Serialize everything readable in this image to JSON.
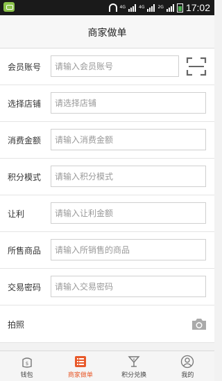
{
  "status_bar": {
    "network_labels": [
      "4G",
      "4G",
      "2G"
    ],
    "time": "17:02"
  },
  "header": {
    "title": "商家做单"
  },
  "form": {
    "fields": [
      {
        "label": "会员账号",
        "placeholder": "请输入会员账号"
      },
      {
        "label": "选择店铺",
        "placeholder": "请选择店铺"
      },
      {
        "label": "消费金额",
        "placeholder": "请输入消费金额"
      },
      {
        "label": "积分模式",
        "placeholder": "请输入积分模式"
      },
      {
        "label": "让利",
        "placeholder": "请输入让利金额"
      },
      {
        "label": "所售商品",
        "placeholder": "请输入所销售的商品"
      },
      {
        "label": "交易密码",
        "placeholder": "请输入交易密码"
      }
    ],
    "photo_label": "拍照"
  },
  "tabbar": {
    "tabs": [
      {
        "label": "钱包",
        "icon": "wallet-icon",
        "active": false
      },
      {
        "label": "商家做单",
        "icon": "order-list-icon",
        "active": true
      },
      {
        "label": "积分兑换",
        "icon": "points-exchange-icon",
        "active": false
      },
      {
        "label": "我的",
        "icon": "user-icon",
        "active": false
      }
    ]
  },
  "colors": {
    "accent": "#e8592a",
    "status_bar": "#1a1a1a",
    "background": "#f2f2f2"
  }
}
